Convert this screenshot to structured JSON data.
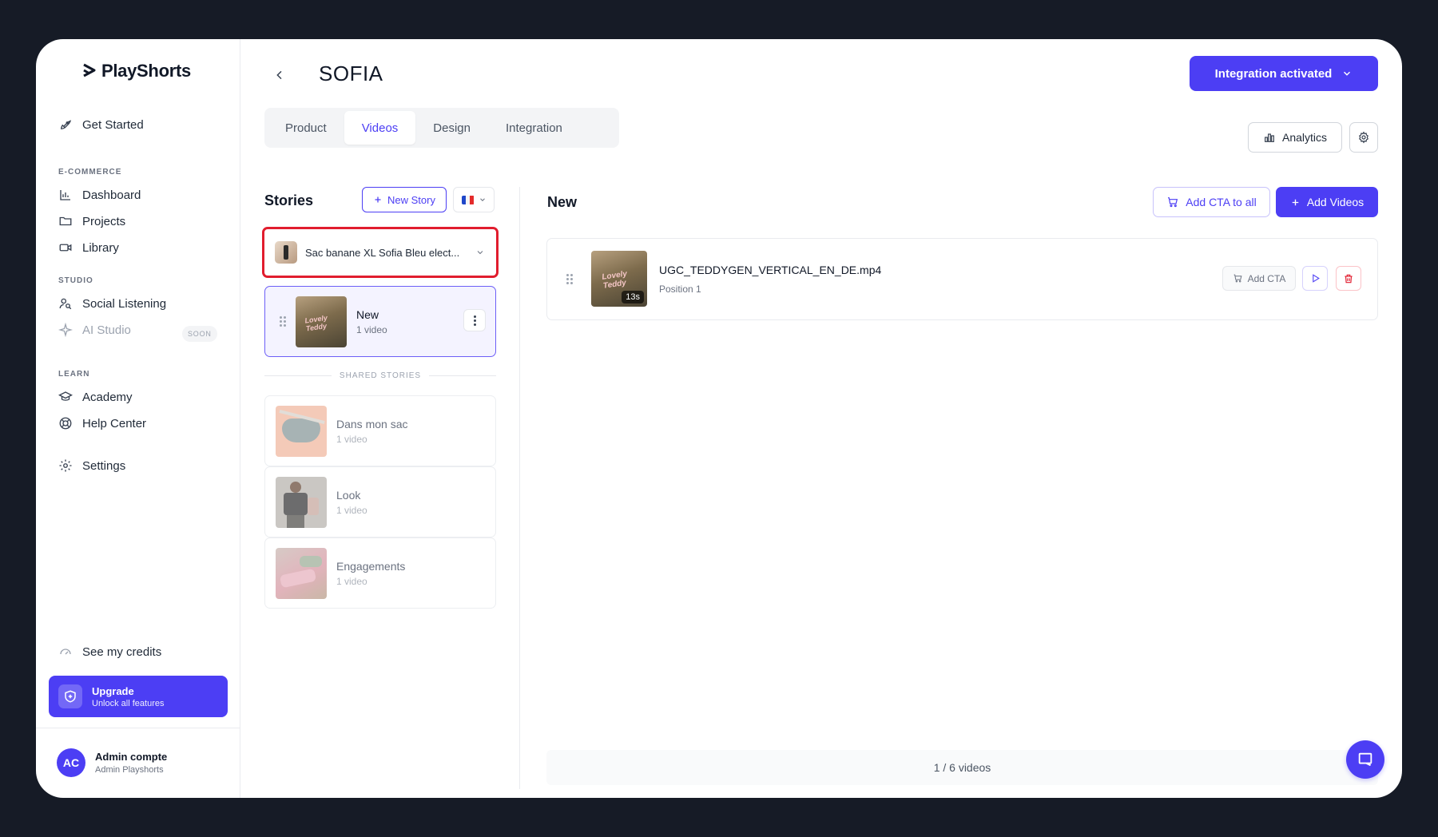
{
  "app": {
    "name": "PlayShorts"
  },
  "sidebar": {
    "get_started": "Get Started",
    "sections": {
      "ecommerce": "E-COMMERCE",
      "studio": "STUDIO",
      "learn": "LEARN"
    },
    "items": {
      "dashboard": "Dashboard",
      "projects": "Projects",
      "library": "Library",
      "social_listening": "Social Listening",
      "ai_studio": "AI Studio",
      "academy": "Academy",
      "help_center": "Help Center",
      "settings": "Settings"
    },
    "soon_badge": "SOON",
    "credits": "See my credits",
    "upgrade": {
      "title": "Upgrade",
      "subtitle": "Unlock all features"
    },
    "user": {
      "initials": "AC",
      "name": "Admin compte",
      "role": "Admin Playshorts"
    }
  },
  "header": {
    "title": "SOFIA",
    "integration_button": "Integration activated",
    "analytics_button": "Analytics"
  },
  "tabs": [
    {
      "label": "Product",
      "active": false
    },
    {
      "label": "Videos",
      "active": true
    },
    {
      "label": "Design",
      "active": false
    },
    {
      "label": "Integration",
      "active": false
    }
  ],
  "stories": {
    "title": "Stories",
    "new_story_button": "New Story",
    "language_flag": "fr",
    "product_select": "Sac banane XL Sofia Bleu elect...",
    "active_story": {
      "name": "New",
      "count": "1 video"
    },
    "shared_label": "SHARED STORIES",
    "shared": [
      {
        "name": "Dans mon sac",
        "count": "1 video"
      },
      {
        "name": "Look",
        "count": "1 video"
      },
      {
        "name": "Engagements",
        "count": "1 video"
      }
    ]
  },
  "panel": {
    "title": "New",
    "add_cta_all": "Add CTA to all",
    "add_videos": "Add Videos",
    "videos": [
      {
        "filename": "UGC_TEDDYGEN_VERTICAL_EN_DE.mp4",
        "position": "Position 1",
        "duration": "13s",
        "thumb_text": "Lovely Teddy",
        "add_cta": "Add CTA"
      }
    ],
    "footer_count": "1 / 6 videos"
  },
  "colors": {
    "accent": "#4c3ef4",
    "highlight_border": "#e11d2e",
    "background": "#161b26"
  }
}
